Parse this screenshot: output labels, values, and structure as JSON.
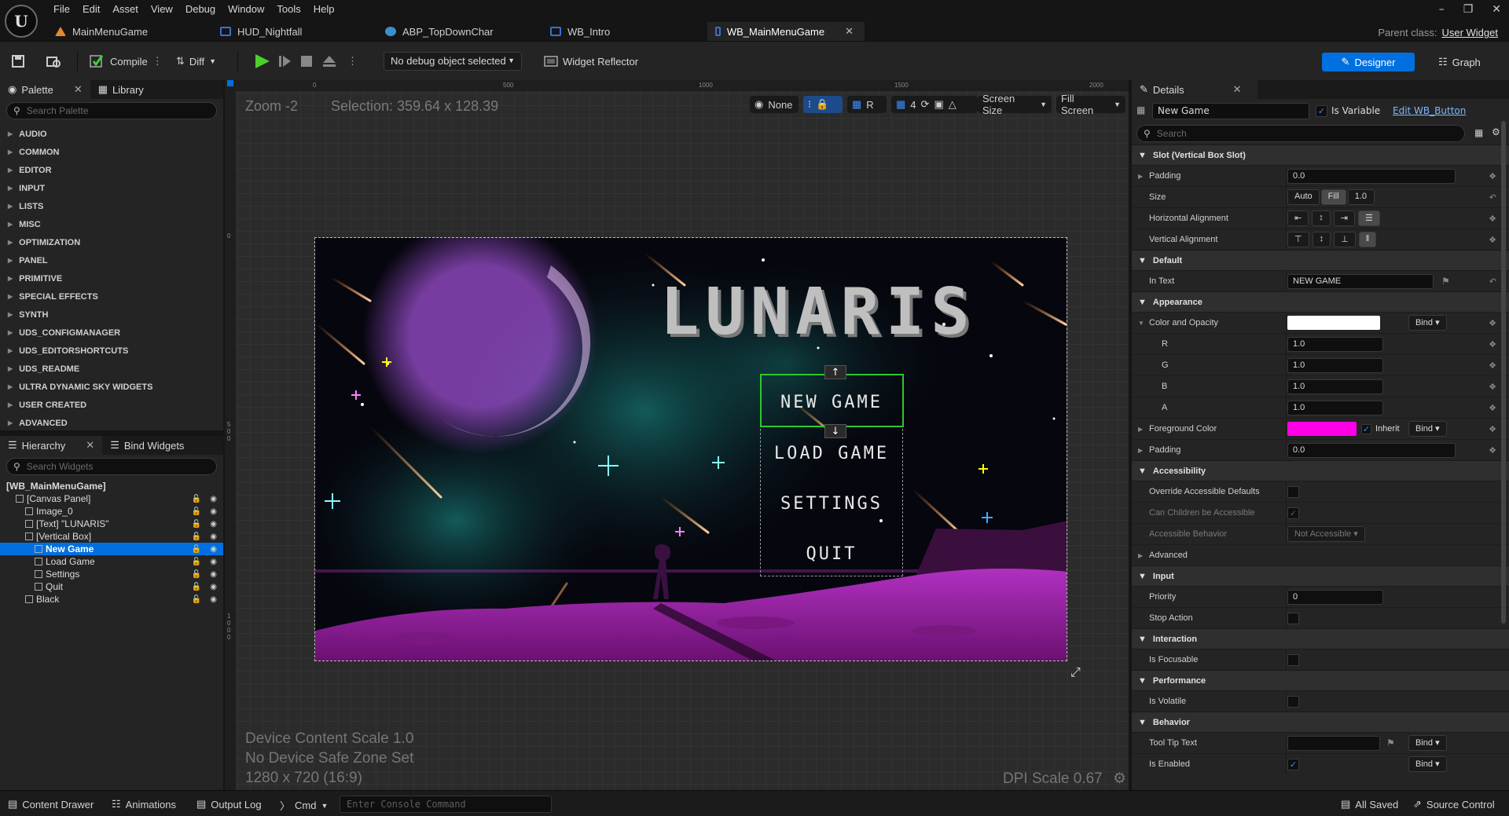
{
  "menu": [
    "File",
    "Edit",
    "Asset",
    "View",
    "Debug",
    "Window",
    "Tools",
    "Help"
  ],
  "tabs": [
    {
      "label": "MainMenuGame",
      "color": "#e08a2e"
    },
    {
      "label": "HUD_Nightfall",
      "color": "#3a6fd0"
    },
    {
      "label": "ABP_TopDownChar",
      "color": "#3a8fd0"
    },
    {
      "label": "WB_Intro",
      "color": "#3a6fd0"
    },
    {
      "label": "WB_MainMenuGame",
      "color": "#3a6fd0",
      "active": true
    }
  ],
  "parent_class": {
    "label": "Parent class:",
    "value": "User Widget"
  },
  "toolbar": {
    "compile": "Compile",
    "diff": "Diff",
    "debug_object": "No debug object selected",
    "widget_reflector": "Widget Reflector",
    "designer": "Designer",
    "graph": "Graph"
  },
  "palette": {
    "tab": "Palette",
    "library_tab": "Library",
    "search_placeholder": "Search Palette",
    "categories": [
      "AUDIO",
      "COMMON",
      "EDITOR",
      "INPUT",
      "LISTS",
      "MISC",
      "OPTIMIZATION",
      "PANEL",
      "PRIMITIVE",
      "SPECIAL EFFECTS",
      "SYNTH",
      "UDS_CONFIGMANAGER",
      "UDS_EDITORSHORTCUTS",
      "UDS_README",
      "ULTRA DYNAMIC SKY WIDGETS",
      "USER CREATED",
      "ADVANCED"
    ]
  },
  "hierarchy": {
    "tab": "Hierarchy",
    "bind_tab": "Bind Widgets",
    "search_placeholder": "Search Widgets",
    "rows": [
      {
        "label": "[WB_MainMenuGame]",
        "indent": 0
      },
      {
        "label": "[Canvas Panel]",
        "indent": 1
      },
      {
        "label": "Image_0",
        "indent": 2
      },
      {
        "label": "[Text] \"LUNARIS\"",
        "indent": 2
      },
      {
        "label": "[Vertical Box]",
        "indent": 2
      },
      {
        "label": "New Game",
        "indent": 3,
        "selected": true
      },
      {
        "label": "Load Game",
        "indent": 3
      },
      {
        "label": "Settings",
        "indent": 3
      },
      {
        "label": "Quit",
        "indent": 3
      },
      {
        "label": "Black",
        "indent": 2
      }
    ]
  },
  "viewport": {
    "zoom": "Zoom -2",
    "selection": "Selection: 359.64 x 128.39",
    "ruler_ticks": [
      "0",
      "500",
      "1000",
      "1500",
      "2000"
    ],
    "ruler_left": [
      "0",
      "500",
      "1000"
    ],
    "none_label": "None",
    "r_label": "R",
    "grid_value": "4",
    "screen_size": "Screen Size",
    "fill_screen": "Fill Screen",
    "device_scale": "Device Content Scale 1.0",
    "safe_zone": "No Device Safe Zone Set",
    "resolution": "1280 x 720 (16:9)",
    "dpi": "DPI Scale 0.67"
  },
  "game": {
    "title": "LUNARIS",
    "buttons": [
      "NEW GAME",
      "LOAD GAME",
      "SETTINGS",
      "QUIT"
    ]
  },
  "details": {
    "tab": "Details",
    "name": "New Game",
    "is_variable": "Is Variable",
    "edit_link": "Edit WB_Button",
    "search_placeholder": "Search",
    "slot_section": "Slot (Vertical Box Slot)",
    "padding_label": "Padding",
    "padding_value": "0.0",
    "size_label": "Size",
    "size_auto": "Auto",
    "size_fill": "Fill",
    "size_value": "1.0",
    "halign_label": "Horizontal Alignment",
    "valign_label": "Vertical Alignment",
    "default_section": "Default",
    "intext_label": "In Text",
    "intext_value": "NEW GAME",
    "appearance_section": "Appearance",
    "color_label": "Color and Opacity",
    "bind": "Bind",
    "r_label": "R",
    "r_value": "1.0",
    "g_label": "G",
    "g_value": "1.0",
    "b_label": "B",
    "b_value": "1.0",
    "a_label": "A",
    "a_value": "1.0",
    "fg_label": "Foreground Color",
    "fg_color": "#ff00e6",
    "inherit": "Inherit",
    "padding2_label": "Padding",
    "padding2_value": "0.0",
    "accessibility_section": "Accessibility",
    "override_label": "Override Accessible Defaults",
    "children_label": "Can Children be Accessible",
    "behavior_label": "Accessible Behavior",
    "behavior_value": "Not Accessible",
    "advanced_label": "Advanced",
    "input_section": "Input",
    "priority_label": "Priority",
    "priority_value": "0",
    "stopaction_label": "Stop Action",
    "interaction_section": "Interaction",
    "focusable_label": "Is Focusable",
    "performance_section": "Performance",
    "volatile_label": "Is Volatile",
    "behavior_section": "Behavior",
    "tooltip_label": "Tool Tip Text",
    "enabled_label": "Is Enabled"
  },
  "statusbar": {
    "content_drawer": "Content Drawer",
    "animations": "Animations",
    "output_log": "Output Log",
    "cmd": "Cmd",
    "console_placeholder": "Enter Console Command",
    "all_saved": "All Saved",
    "source_control": "Source Control"
  },
  "colors": {
    "accent": "#0070e0",
    "selection_outline": "#2ec82e",
    "moon": "#c070ff",
    "ground": "#a020b0"
  }
}
